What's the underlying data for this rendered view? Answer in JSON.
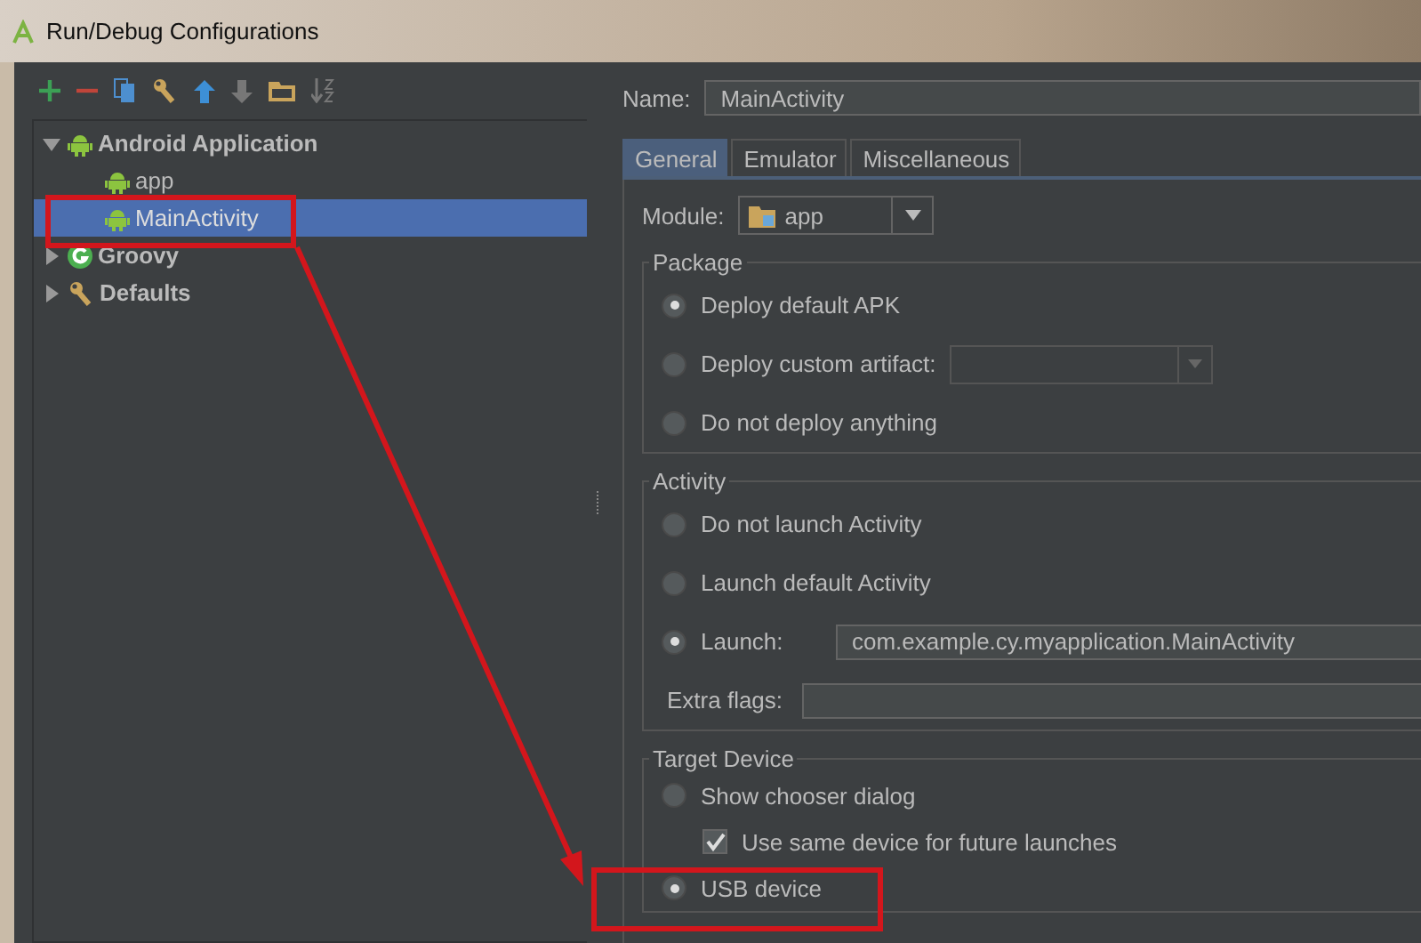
{
  "window": {
    "title": "Run/Debug Configurations"
  },
  "tree": [
    {
      "label": "Android Application",
      "kind": "android",
      "expanded": true,
      "selected": false,
      "children": [
        {
          "label": "app",
          "kind": "android",
          "selected": false
        },
        {
          "label": "MainActivity",
          "kind": "android",
          "selected": true
        }
      ]
    },
    {
      "label": "Groovy",
      "kind": "groovy",
      "expanded": false,
      "selected": false
    },
    {
      "label": "Defaults",
      "kind": "defaults",
      "expanded": false,
      "selected": false
    }
  ],
  "name": {
    "label": "Name:",
    "value": "MainActivity"
  },
  "tabs": [
    {
      "label": "General",
      "selected": true
    },
    {
      "label": "Emulator",
      "selected": false
    },
    {
      "label": "Miscellaneous",
      "selected": false
    }
  ],
  "module": {
    "label": "Module:",
    "value": "app"
  },
  "groups": [
    {
      "title": "Package",
      "rows": [
        {
          "kind": "radio",
          "label": "Deploy default APK",
          "selected": true
        },
        {
          "kind": "radio-combo",
          "label": "Deploy custom artifact:",
          "selected": false
        },
        {
          "kind": "radio",
          "label": "Do not deploy anything",
          "selected": false
        }
      ]
    },
    {
      "title": "Activity",
      "rows": [
        {
          "kind": "radio",
          "label": "Do not launch Activity",
          "selected": false
        },
        {
          "kind": "radio",
          "label": "Launch default Activity",
          "selected": false
        },
        {
          "kind": "radio-field",
          "label": "Launch:",
          "selected": true,
          "value": "com.example.cy.myapplication.MainActivity"
        },
        {
          "kind": "field",
          "label": "Extra flags:"
        }
      ]
    },
    {
      "title": "Target Device",
      "rows": [
        {
          "kind": "radio",
          "label": "Show chooser dialog",
          "selected": false
        },
        {
          "kind": "checkbox",
          "label": "Use same device for future launches",
          "checked": true
        },
        {
          "kind": "radio",
          "label": "USB device",
          "selected": true
        }
      ]
    }
  ]
}
